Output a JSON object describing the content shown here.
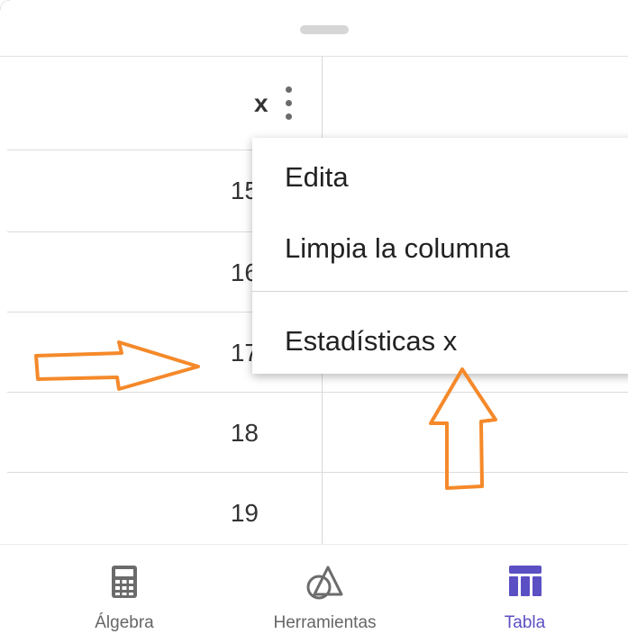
{
  "table": {
    "header": "x",
    "rows": [
      "15",
      "16",
      "17",
      "18",
      "19"
    ]
  },
  "context_menu": {
    "items": [
      "Edita",
      "Limpia la columna",
      "Estadísticas x"
    ]
  },
  "bottom_nav": {
    "items": [
      {
        "label": "Álgebra",
        "icon": "calculator-icon",
        "active": false
      },
      {
        "label": "Herramientas",
        "icon": "tools-shapes-icon",
        "active": false
      },
      {
        "label": "Tabla",
        "icon": "table-icon",
        "active": true
      }
    ]
  },
  "colors": {
    "accent": "#5b4fc4",
    "annotation_arrow": "#f5892a",
    "divider": "#dcdcdc"
  }
}
